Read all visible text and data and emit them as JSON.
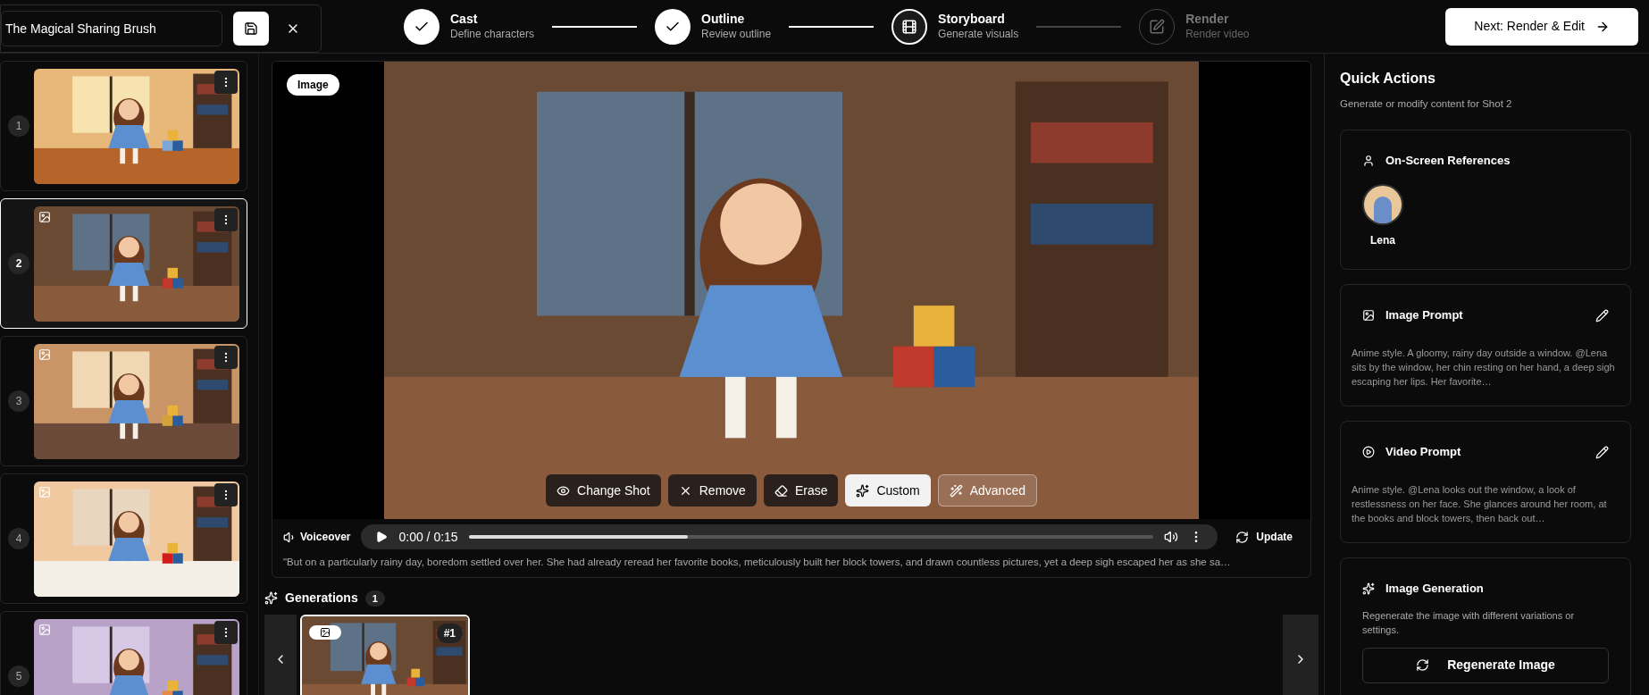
{
  "header": {
    "title_value": "The Magical Sharing Brush",
    "next_button": "Next: Render & Edit"
  },
  "steps": [
    {
      "title": "Cast",
      "subtitle": "Define characters",
      "completed": true,
      "selected": false
    },
    {
      "title": "Outline",
      "subtitle": "Review outline",
      "completed": true,
      "selected": false
    },
    {
      "title": "Storyboard",
      "subtitle": "Generate visuals",
      "completed": false,
      "selected": true
    },
    {
      "title": "Render",
      "subtitle": "Render video",
      "completed": false,
      "selected": false
    }
  ],
  "shots": [
    {
      "number": "1",
      "selected": false,
      "image_icon": false
    },
    {
      "number": "2",
      "selected": true,
      "image_icon": true
    },
    {
      "number": "3",
      "selected": false,
      "image_icon": true
    },
    {
      "number": "4",
      "selected": false,
      "image_icon": true
    },
    {
      "number": "5",
      "selected": false,
      "image_icon": true
    }
  ],
  "preview": {
    "badge": "Image",
    "tools": [
      {
        "label": "Change Shot",
        "kind": "eye",
        "selected": false
      },
      {
        "label": "Remove",
        "kind": "remove",
        "selected": false
      },
      {
        "label": "Erase",
        "kind": "erase",
        "selected": false
      },
      {
        "label": "Custom",
        "kind": "custom",
        "selected": true
      },
      {
        "label": "Advanced",
        "kind": "advanced",
        "selected": false
      }
    ]
  },
  "voiceover": {
    "label": "Voiceover",
    "time": "0:00 / 0:15",
    "level": 0.32,
    "update_button": "Update",
    "text": "\"But on a particularly rainy day, boredom settled over her. She had already reread her favorite books, meticulously built her block towers, and drawn countless pictures, yet a deep sigh escaped her as she sa…"
  },
  "generations": {
    "title": "Generations",
    "count": "1",
    "items": [
      {
        "label": "#1",
        "selected": true
      }
    ]
  },
  "quick_actions": {
    "title": "Quick Actions",
    "subtitle": "Generate or modify content for Shot 2",
    "references": {
      "title": "On-Screen References",
      "people": [
        {
          "name": "Lena"
        }
      ]
    },
    "image_prompt": {
      "title": "Image Prompt",
      "text": "Anime style. A gloomy, rainy day outside a window. @Lena sits by the window, her chin resting on her hand, a deep sigh escaping her lips. Her favorite…"
    },
    "video_prompt": {
      "title": "Video Prompt",
      "text": "Anime style. @Lena looks out the window, a look of restlessness on her face. She glances around her room, at the books and block towers, then back out…"
    },
    "image_generation": {
      "title": "Image Generation",
      "text": "Regenerate the image with different variations or settings.",
      "button": "Regenerate Image"
    }
  }
}
